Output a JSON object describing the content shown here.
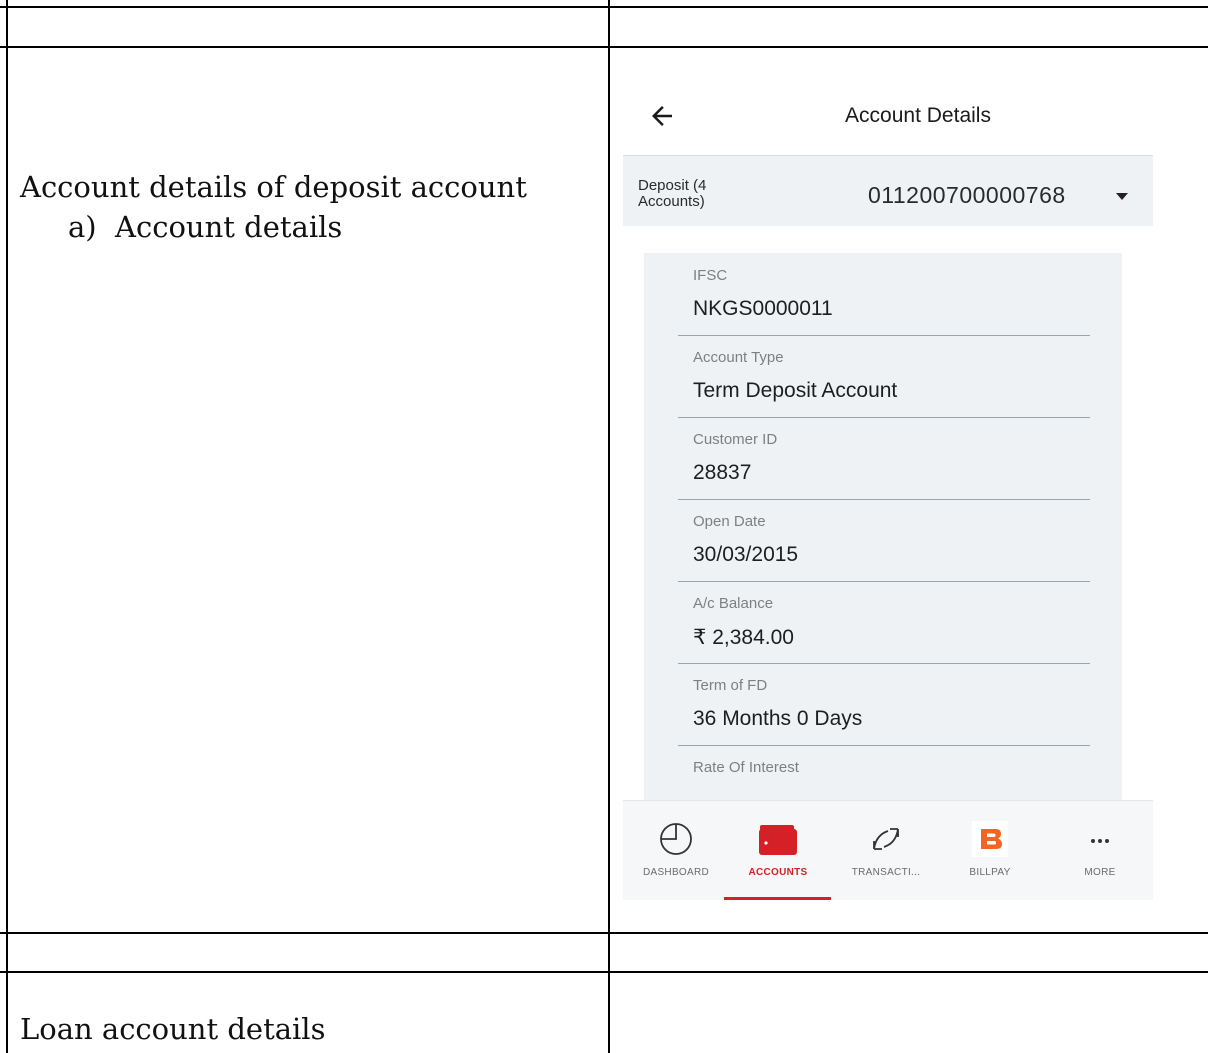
{
  "document": {
    "row1_left": "",
    "row1_right": "",
    "heading": "Account details of deposit account",
    "subitem": "a)  Account details",
    "loan_heading": "Loan account details"
  },
  "phone": {
    "appbar": {
      "back_icon": "arrow-left-icon",
      "title": "Account Details"
    },
    "selector": {
      "label": "Deposit (4 Accounts)",
      "value": "011200700000768",
      "dropdown_icon": "caret-down-icon"
    },
    "fields": [
      {
        "label": "IFSC",
        "value": "NKGS0000011"
      },
      {
        "label": "Account Type",
        "value": "Term Deposit Account"
      },
      {
        "label": "Customer ID",
        "value": "28837"
      },
      {
        "label": "Open Date",
        "value": "30/03/2015"
      },
      {
        "label": "A/c Balance",
        "value": "₹ 2,384.00"
      },
      {
        "label": "Term of FD",
        "value": "36 Months 0 Days"
      },
      {
        "label": "Rate Of Interest",
        "value": ""
      }
    ],
    "bottom_nav": [
      {
        "label": "DASHBOARD",
        "icon": "pie-chart-icon",
        "active": false
      },
      {
        "label": "ACCOUNTS",
        "icon": "wallet-icon",
        "active": true
      },
      {
        "label": "TRANSACTI...",
        "icon": "refresh-arrows-icon",
        "active": false
      },
      {
        "label": "BILLPAY",
        "icon": "billpay-b-icon",
        "active": false
      },
      {
        "label": "MORE",
        "icon": "more-dots-icon",
        "active": false
      }
    ],
    "colors": {
      "accent": "#d42026",
      "billpay": "#f26522",
      "panel": "#eef2f5"
    }
  }
}
